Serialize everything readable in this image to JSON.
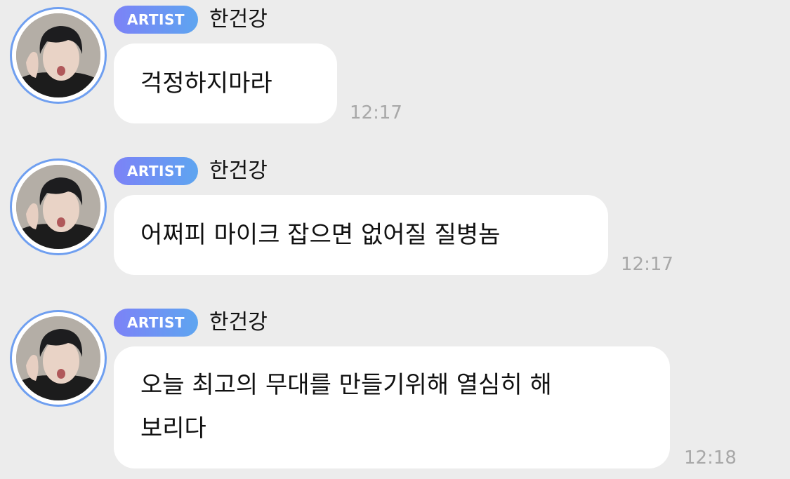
{
  "messages": [
    {
      "badge": "ARTIST",
      "sender": "한건강",
      "text": "걱정하지마라",
      "time": "12:17"
    },
    {
      "badge": "ARTIST",
      "sender": "한건강",
      "text": "어쩌피 마이크 잡으면 없어질 질병놈",
      "time": "12:17"
    },
    {
      "badge": "ARTIST",
      "sender": "한건강",
      "text_line1": "오늘 최고의 무대를 만들기위해 열심히 해",
      "text_line2": "보리다",
      "time": "12:18"
    }
  ],
  "colors": {
    "background": "#ececec",
    "bubble": "#ffffff",
    "badge_start": "#7c82f7",
    "badge_end": "#5ea5f0",
    "avatar_ring": "#6f9ff0",
    "timestamp": "#a8a8a8"
  }
}
